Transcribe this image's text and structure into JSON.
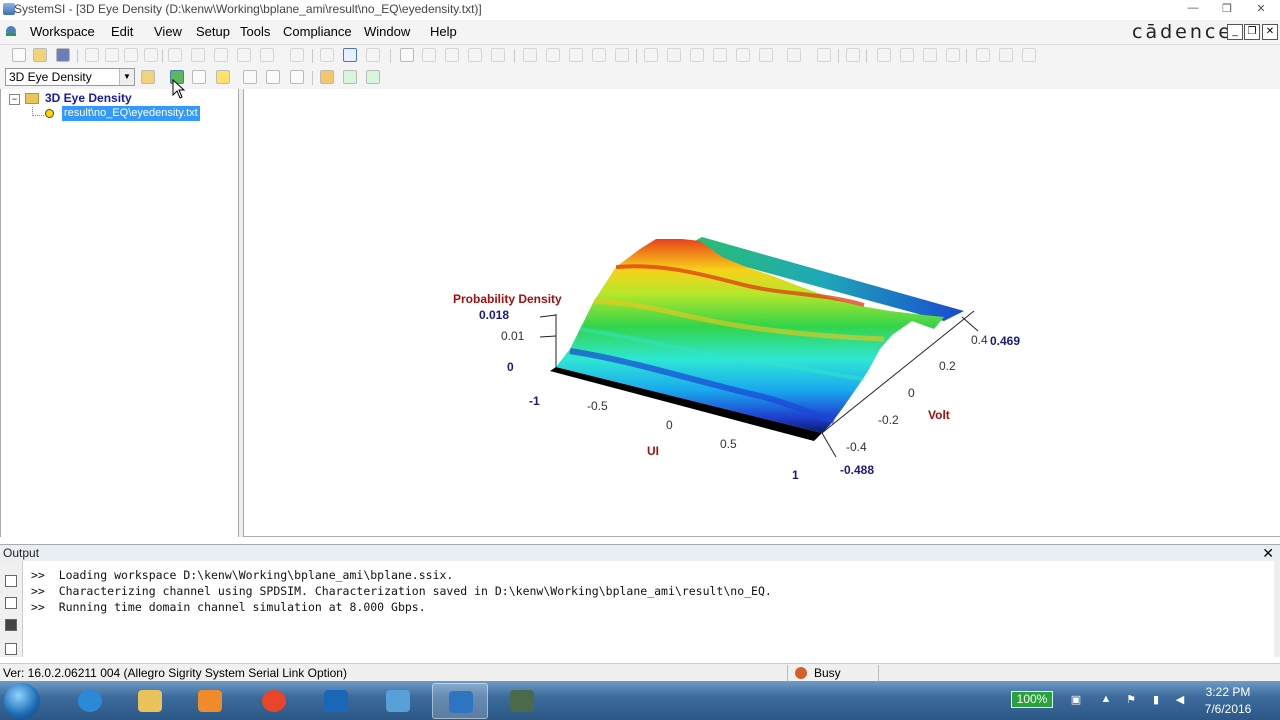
{
  "window": {
    "title": "SystemSI - [3D Eye Density (D:\\kenw\\Working\\bplane_ami\\result\\no_EQ\\eyedensity.txt)]",
    "controls": [
      "—",
      "❐",
      "✕"
    ],
    "brand_logo": "cādence"
  },
  "menu": [
    "Workspace",
    "Edit",
    "View",
    "Setup",
    "Tools",
    "Compliance",
    "Window",
    "Help"
  ],
  "mdi_controls": [
    "_",
    "❐",
    "✕"
  ],
  "toolbar2": {
    "view_select": "3D Eye Density"
  },
  "tree": {
    "root_label": "3D Eye Density",
    "child_label": "result\\no_EQ\\eyedensity.txt",
    "expander": "−"
  },
  "chart": {
    "z_label": "Probability Density",
    "z_ticks": [
      "0.018",
      "0.01",
      "0"
    ],
    "ui_label": "UI",
    "ui_ticks": [
      "-1",
      "-0.5",
      "0",
      "0.5",
      "1"
    ],
    "volt_label": "Volt",
    "volt_ticks": [
      "0.4",
      "0.2",
      "0",
      "-0.2",
      "-0.4"
    ],
    "volt_max": "0.469",
    "volt_min": "-0.488",
    "colors": {
      "blue_labels": "#1a1a80",
      "red_labels": "#a01010"
    }
  },
  "chart_data": {
    "type": "surface3d",
    "zlabel": "Probability Density",
    "xlabel": "UI",
    "ylabel": "Volt",
    "xlim": [
      -1,
      1
    ],
    "ylim": [
      -0.488,
      0.469
    ],
    "zlim": [
      0,
      0.018
    ],
    "x_ticks": [
      -1,
      -0.5,
      0,
      0.5,
      1
    ],
    "y_ticks": [
      0.4,
      0.2,
      0,
      -0.2,
      -0.4
    ],
    "z_ticks": [
      0.018,
      0.01,
      0
    ]
  },
  "output": {
    "title": "Output",
    "close": "✕",
    "lines": [
      ">>  Loading workspace D:\\kenw\\Working\\bplane_ami\\bplane.ssix.",
      ">>  Characterizing channel using SPDSIM. Characterization saved in D:\\kenw\\Working\\bplane_ami\\result\\no_EQ.",
      ">>  Running time domain channel simulation at 8.000 Gbps."
    ]
  },
  "status": {
    "version": "Ver: 16.0.2.06211  004 (Allegro Sigrity System Serial Link Option)",
    "busy": "Busy"
  },
  "taskbar": {
    "battery": "100%",
    "time": "3:22 PM",
    "date": "7/6/2016"
  }
}
